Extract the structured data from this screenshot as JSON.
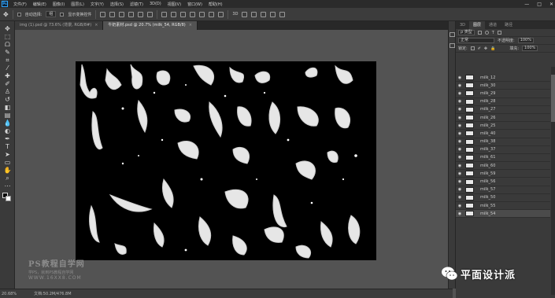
{
  "app": {
    "logo": "Ps",
    "menus": [
      "文件(F)",
      "编辑(E)",
      "图像(I)",
      "图层(L)",
      "文字(Y)",
      "选择(S)",
      "滤镜(T)",
      "3D(D)",
      "视图(V)",
      "窗口(W)",
      "帮助(H)"
    ],
    "window_controls": [
      "—",
      "□",
      "✕"
    ]
  },
  "options": {
    "auto_select_label": "自动选择:",
    "auto_select_value": "组",
    "show_transform_label": "显示变换控件"
  },
  "tabs": [
    {
      "label": "img (1).psd @ 73.6% (背景, RGB/8#)",
      "close": "×",
      "active": false
    },
    {
      "label": "牛奶素材.psd @ 20.7% (milk_54, RGB/8)",
      "close": "×",
      "active": true
    }
  ],
  "status": {
    "zoom": "20.68%",
    "doc": "文档:50.2M/476.8M"
  },
  "watermark": {
    "title": "PS教程自学网",
    "subtitle": "学PS，就到PS教程自学网",
    "url": "WWW.16XX8.COM",
    "right_text": "平面设计派"
  },
  "panel": {
    "tabs": [
      "3D",
      "图层",
      "通道",
      "路径"
    ],
    "active_tab": 1,
    "filter_label": "ρ 类型",
    "blend_mode": "正常",
    "opacity_label": "不透明度:",
    "opacity_value": "100%",
    "lock_label": "锁定:",
    "fill_label": "填充:",
    "fill_value": "100%"
  },
  "layers": [
    {
      "name": "milk_12",
      "selected": false
    },
    {
      "name": "milk_30",
      "selected": false
    },
    {
      "name": "milk_29",
      "selected": false
    },
    {
      "name": "milk_28",
      "selected": false
    },
    {
      "name": "milk_27",
      "selected": false
    },
    {
      "name": "milk_26",
      "selected": false
    },
    {
      "name": "milk_25",
      "selected": false
    },
    {
      "name": "milk_40",
      "selected": false
    },
    {
      "name": "milk_38",
      "selected": false
    },
    {
      "name": "milk_37",
      "selected": false
    },
    {
      "name": "milk_61",
      "selected": false
    },
    {
      "name": "milk_60",
      "selected": false
    },
    {
      "name": "milk_59",
      "selected": false
    },
    {
      "name": "milk_56",
      "selected": false
    },
    {
      "name": "milk_57",
      "selected": false
    },
    {
      "name": "milk_50",
      "selected": false
    },
    {
      "name": "milk_55",
      "selected": false
    },
    {
      "name": "milk_54",
      "selected": true
    }
  ],
  "tools": [
    {
      "icon": "move-tool-icon",
      "glyph": "✥"
    },
    {
      "icon": "marquee-tool-icon",
      "glyph": "⬚"
    },
    {
      "icon": "lasso-tool-icon",
      "glyph": "ᗝ"
    },
    {
      "icon": "quick-select-icon",
      "glyph": "✎"
    },
    {
      "icon": "crop-tool-icon",
      "glyph": "⌗"
    },
    {
      "icon": "eyedropper-icon",
      "glyph": "⁄"
    },
    {
      "icon": "healing-brush-icon",
      "glyph": "✚"
    },
    {
      "icon": "brush-tool-icon",
      "glyph": "✐"
    },
    {
      "icon": "clone-stamp-icon",
      "glyph": "♙"
    },
    {
      "icon": "history-brush-icon",
      "glyph": "↺"
    },
    {
      "icon": "eraser-tool-icon",
      "glyph": "◧"
    },
    {
      "icon": "gradient-tool-icon",
      "glyph": "▤"
    },
    {
      "icon": "blur-tool-icon",
      "glyph": "💧"
    },
    {
      "icon": "dodge-tool-icon",
      "glyph": "◐"
    },
    {
      "icon": "pen-tool-icon",
      "glyph": "✒"
    },
    {
      "icon": "type-tool-icon",
      "glyph": "T"
    },
    {
      "icon": "path-select-icon",
      "glyph": "➤"
    },
    {
      "icon": "shape-tool-icon",
      "glyph": "▭"
    },
    {
      "icon": "hand-tool-icon",
      "glyph": "✋"
    },
    {
      "icon": "zoom-tool-icon",
      "glyph": "⌕"
    },
    {
      "icon": "more-tools-icon",
      "glyph": "⋯"
    }
  ]
}
